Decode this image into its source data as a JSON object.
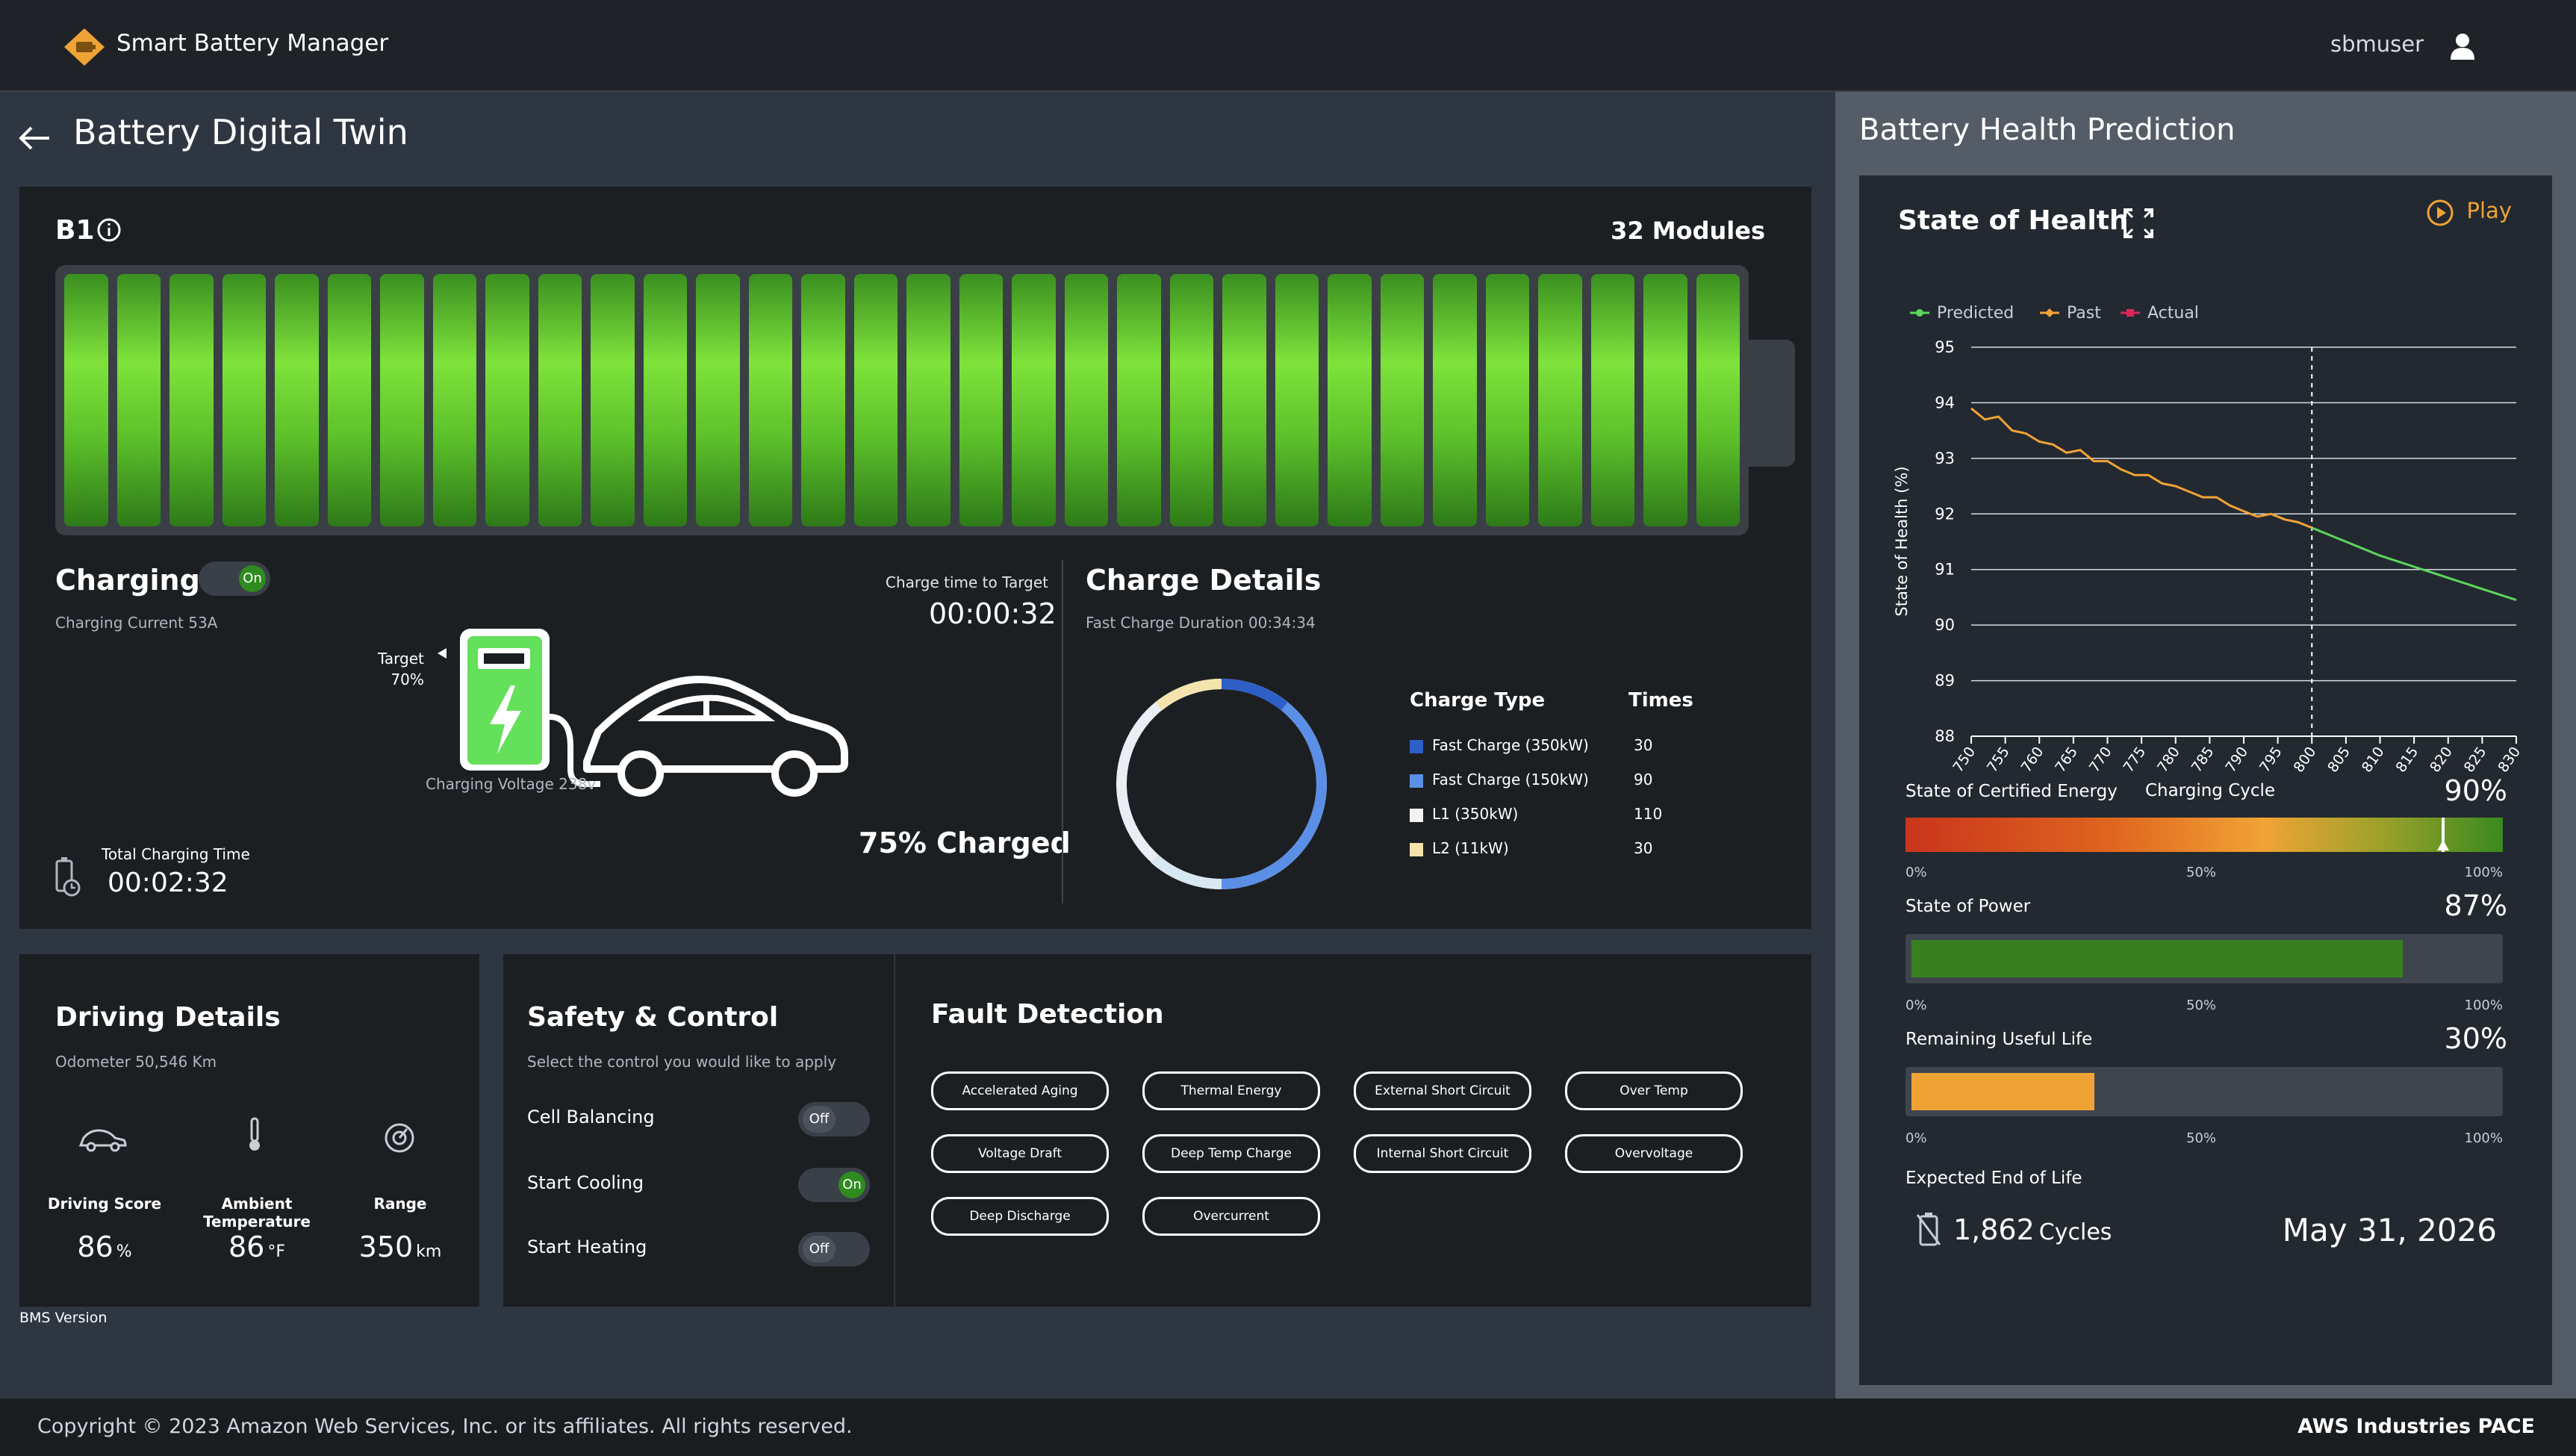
{
  "app": {
    "title": "Smart Battery Manager",
    "user": "sbmuser"
  },
  "page": {
    "title": "Battery Digital Twin"
  },
  "battery": {
    "id": "B1",
    "modules_label": "32 Modules",
    "cell_count": 32
  },
  "charging": {
    "label": "Charging",
    "toggle": "On",
    "current": "Charging Current 53A",
    "target_label": "Target",
    "target_value": "70%",
    "voltage": "Charging Voltage 238v",
    "time_to_target_label": "Charge time to Target",
    "time_to_target": "00:00:32",
    "charged": "75% Charged",
    "total_time_label": "Total Charging Time",
    "total_time": "00:02:32"
  },
  "charge_details": {
    "title": "Charge Details",
    "subtitle": "Fast Charge Duration 00:34:34",
    "type_header": "Charge Type",
    "times_header": "Times",
    "rows": [
      {
        "label": "Fast Charge (350kW)",
        "count": "30",
        "color": "#2e5fc7"
      },
      {
        "label": "Fast Charge (150kW)",
        "count": "90",
        "color": "#5b8fe6"
      },
      {
        "label": "L1 (350kW)",
        "count": "110",
        "color": "#f2f2f2"
      },
      {
        "label": "L2 (11kW)",
        "count": "30",
        "color": "#f4e3ad"
      }
    ]
  },
  "driving": {
    "title": "Driving Details",
    "odometer": "Odometer 50,546 Km",
    "score_label": "Driving Score",
    "score_value": "86",
    "score_unit": "%",
    "temp_label": "Ambient Temperature",
    "temp_value": "86",
    "temp_unit": "°F",
    "range_label": "Range",
    "range_value": "350",
    "range_unit": "km"
  },
  "safety": {
    "title": "Safety & Control",
    "subtitle": "Select the control you would like to apply",
    "controls": [
      {
        "label": "Cell Balancing",
        "state": "Off"
      },
      {
        "label": "Start Cooling",
        "state": "On"
      },
      {
        "label": "Start Heating",
        "state": "Off"
      }
    ]
  },
  "fault": {
    "title": "Fault Detection",
    "items": [
      "Accelerated Aging",
      "Thermal Energy",
      "External Short Circuit",
      "Over Temp",
      "Voltage Draft",
      "Deep Temp Charge",
      "Internal Short Circuit",
      "Overvoltage",
      "Deep Discharge",
      "Overcurrent"
    ]
  },
  "bms_version": "BMS Version",
  "prediction": {
    "title": "Battery Health Prediction",
    "soh_title": "State of Health",
    "play": "Play",
    "legend": {
      "predicted": "Predicted",
      "past": "Past",
      "actual": "Actual"
    },
    "certified_energy_label": "State of Certified Energy",
    "certified_energy": "90%",
    "certified_energy_value": 0.9,
    "power_label": "State of Power",
    "power": "87%",
    "power_value": 0.87,
    "rul_label": "Remaining Useful Life",
    "rul": "30%",
    "rul_value": 0.3,
    "scale": [
      "0%",
      "50%",
      "100%"
    ],
    "eol_label": "Expected End of Life",
    "eol_cycles": "1,862",
    "eol_cycles_unit": "Cycles",
    "eol_date": "May 31, 2026"
  },
  "chart_data": {
    "type": "line",
    "title": "State of Health",
    "xlabel": "Charging Cycle",
    "ylabel": "State of Health (%)",
    "xlim": [
      750,
      830
    ],
    "ylim": [
      88,
      95
    ],
    "x_ticks": [
      "750",
      "755",
      "760",
      "765",
      "770",
      "775",
      "780",
      "785",
      "790",
      "795",
      "800",
      "805",
      "810",
      "815",
      "820",
      "825",
      "830"
    ],
    "y_ticks": [
      "88",
      "89",
      "90",
      "91",
      "92",
      "93",
      "94",
      "95"
    ],
    "divider_x": 800,
    "grid": true,
    "legend_position": "top-left",
    "series": [
      {
        "name": "Past",
        "color": "#f0a335",
        "x": [
          750,
          752,
          754,
          756,
          758,
          760,
          762,
          764,
          766,
          768,
          770,
          772,
          774,
          776,
          778,
          780,
          782,
          784,
          786,
          788,
          790,
          792,
          794,
          796,
          798,
          800
        ],
        "y": [
          93.9,
          93.7,
          93.75,
          93.5,
          93.45,
          93.3,
          93.25,
          93.1,
          93.15,
          92.95,
          92.95,
          92.8,
          92.7,
          92.7,
          92.55,
          92.5,
          92.4,
          92.3,
          92.3,
          92.15,
          92.05,
          91.95,
          92.0,
          91.9,
          91.85,
          91.75
        ]
      },
      {
        "name": "Predicted",
        "color": "#5cd65c",
        "x": [
          800,
          805,
          810,
          815,
          820,
          825,
          830
        ],
        "y": [
          91.75,
          91.5,
          91.25,
          91.05,
          90.85,
          90.65,
          90.45
        ]
      },
      {
        "name": "Actual",
        "color": "#e0245e",
        "x": [],
        "y": []
      }
    ]
  }
}
